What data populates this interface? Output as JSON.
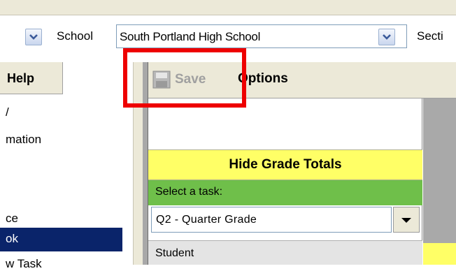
{
  "filters": {
    "school_label": "School",
    "school_value": "South Portland High School",
    "section_label": "Secti"
  },
  "menu": {
    "help_tab": "Help"
  },
  "nav": {
    "items": [
      {
        "label": "/",
        "selected": false
      },
      {
        "label": "mation",
        "selected": false
      },
      {
        "label": "ce",
        "selected": false
      },
      {
        "label": "ok",
        "selected": true
      },
      {
        "label": "w Task",
        "selected": false
      }
    ]
  },
  "toolbar": {
    "save_label": "Save",
    "options_label": "Options",
    "save_icon": "floppy-disk-icon"
  },
  "gradebook": {
    "hide_totals_label": "Hide Grade Totals",
    "task_prompt": "Select a task:",
    "task_selected": "Q2 - Quarter Grade",
    "student_header": "Student"
  },
  "colors": {
    "highlight": "#ee0000",
    "yellow": "#ffff66",
    "green": "#6fbf4a",
    "selected_nav": "#0a246a"
  }
}
